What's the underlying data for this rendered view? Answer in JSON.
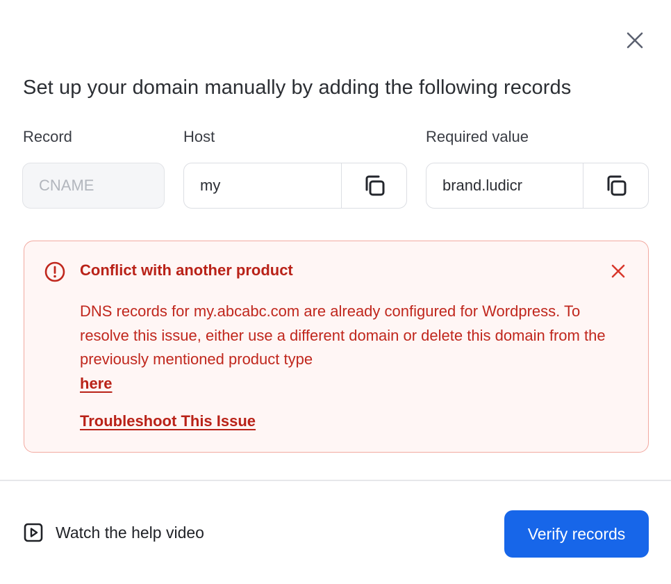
{
  "dialog": {
    "title": "Set up your domain manually by adding the following records"
  },
  "columns": {
    "record_label": "Record",
    "host_label": "Host",
    "value_label": "Required value"
  },
  "fields": {
    "record_value": "CNAME",
    "host_value": "my",
    "required_value": "brand.ludicr"
  },
  "alert": {
    "title": "Conflict with another product",
    "body": "DNS records for my.abcabc.com are already configured for Wordpress. To resolve this issue, either use a different domain or delete this domain from the previously mentioned product type",
    "link_label": "here",
    "troubleshoot_label": "Troubleshoot This Issue",
    "color": "#c0271d"
  },
  "footer": {
    "help_label": "Watch the help video",
    "verify_label": "Verify records",
    "verify_color": "#1766e9"
  },
  "icons": {
    "close": "close-icon",
    "copy": "copy-icon",
    "alert": "alert-circle-icon",
    "alert_close": "close-icon",
    "play": "play-video-icon"
  }
}
